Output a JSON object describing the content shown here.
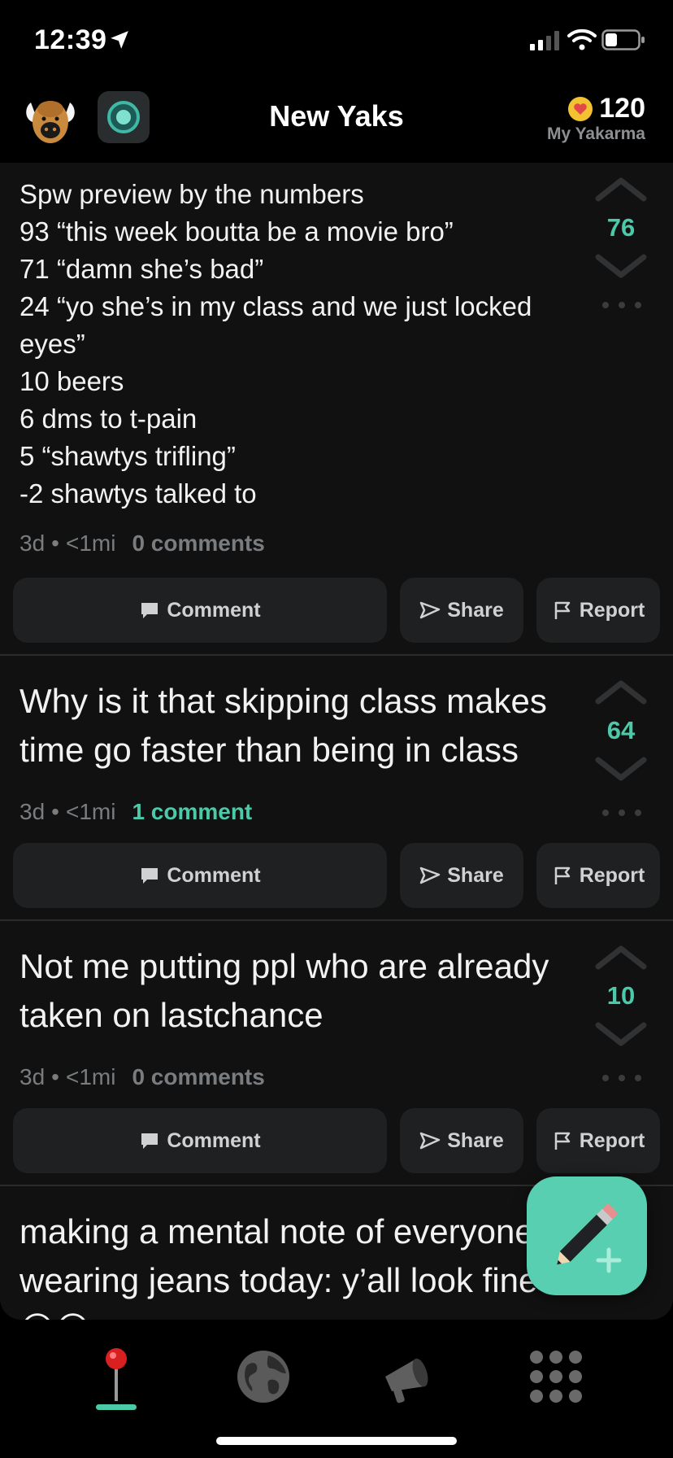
{
  "status_bar": {
    "time": "12:39"
  },
  "header": {
    "title": "New Yaks",
    "karma_value": "120",
    "karma_label": "My Yakarma"
  },
  "posts": [
    {
      "text": "Spw preview by the numbers\n93 “this week boutta be a movie bro”\n71 “damn she’s bad”\n24 “yo she’s in my class and we just locked eyes”\n10 beers\n6 dms to t-pain\n5 “shawtys trifling”\n-2 shawtys talked to",
      "age": "3d",
      "distance": "<1mi",
      "comments": "0 comments",
      "votes": "76"
    },
    {
      "text": "Why is it that skipping class makes time go faster than being in class",
      "age": "3d",
      "distance": "<1mi",
      "comments": "1 comment",
      "votes": "64"
    },
    {
      "text": "Not me putting ppl who are already taken on lastchance",
      "age": "3d",
      "distance": "<1mi",
      "comments": "0 comments",
      "votes": "10"
    },
    {
      "text": "making a mental note of everyone wearing jeans today: y’all look fine af 😍😍"
    }
  ],
  "actions": {
    "comment": "Comment",
    "share": "Share",
    "report": "Report"
  },
  "meta_separator": "•",
  "colors": {
    "accent": "#4cc9a9",
    "fab": "#57cfb0",
    "card": "#1f2021",
    "feed_bg": "#111111"
  },
  "icons": {
    "tabs": [
      "pin-icon",
      "globe-icon",
      "megaphone-icon",
      "grid-icon"
    ],
    "fab": "pencil-plus-icon"
  }
}
